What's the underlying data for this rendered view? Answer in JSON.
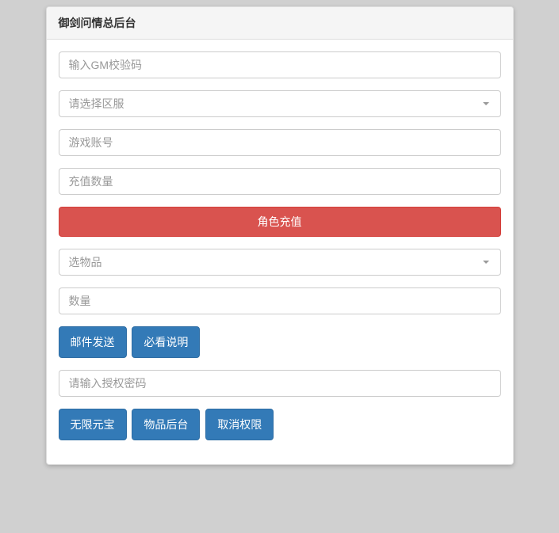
{
  "panel": {
    "title": "御剑问情总后台"
  },
  "inputs": {
    "gm_code_placeholder": "输入GM校验码",
    "server_select_placeholder": "请选择区服",
    "account_placeholder": "游戏账号",
    "recharge_amount_placeholder": "充值数量",
    "item_select_placeholder": "选物品",
    "quantity_placeholder": "数量",
    "auth_password_placeholder": "请输入授权密码"
  },
  "buttons": {
    "role_recharge": "角色充值",
    "mail_send": "邮件发送",
    "must_read": "必看说明",
    "unlimited_yuanbao": "无限元宝",
    "item_backend": "物品后台",
    "cancel_permission": "取消权限"
  }
}
